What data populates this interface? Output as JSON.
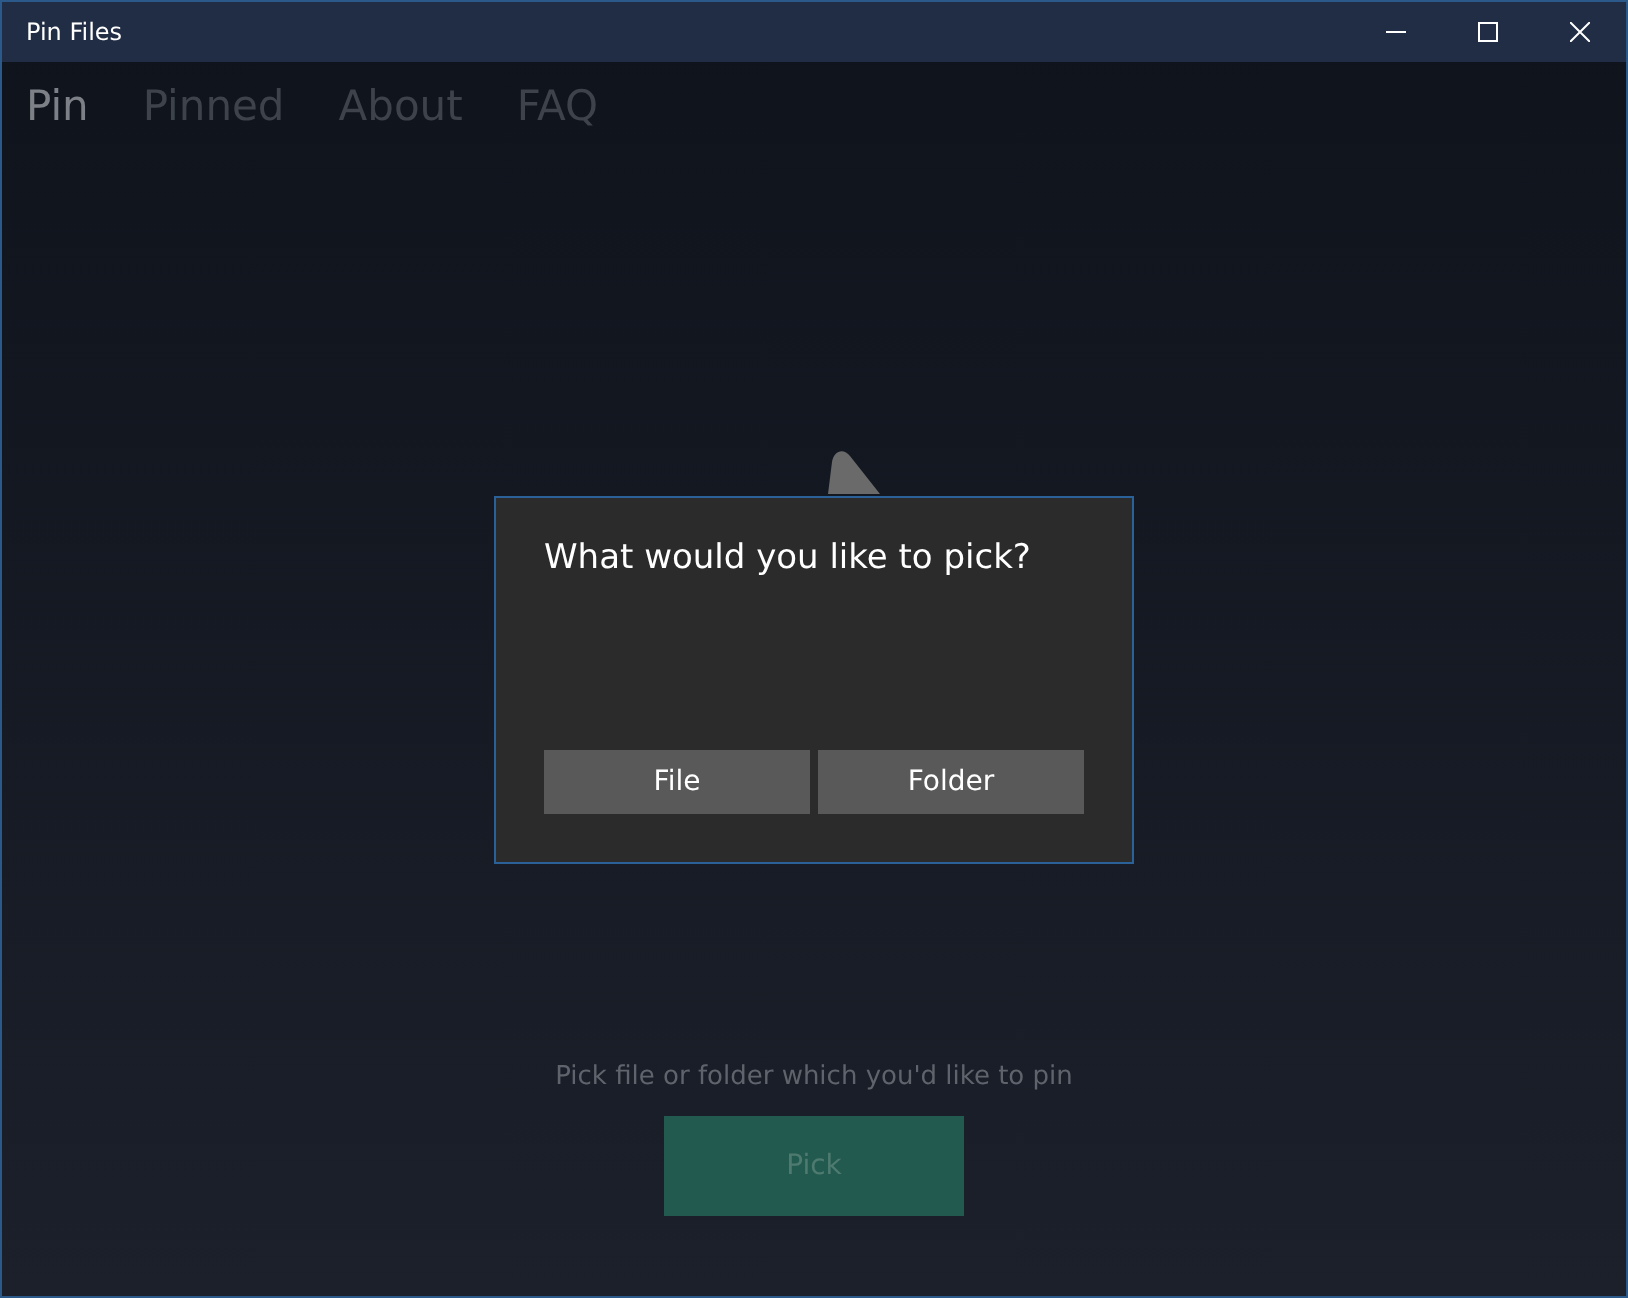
{
  "window": {
    "title": "Pin Files"
  },
  "tabs": [
    {
      "label": "Pin",
      "selected": true
    },
    {
      "label": "Pinned",
      "selected": false
    },
    {
      "label": "About",
      "selected": false
    },
    {
      "label": "FAQ",
      "selected": false
    }
  ],
  "prompt": "Pick file or folder which you'd like to pin",
  "pick_button": {
    "label": "Pick",
    "disabled": true
  },
  "dialog": {
    "title": "What would you like to pick?",
    "buttons": [
      "File",
      "Folder"
    ]
  }
}
